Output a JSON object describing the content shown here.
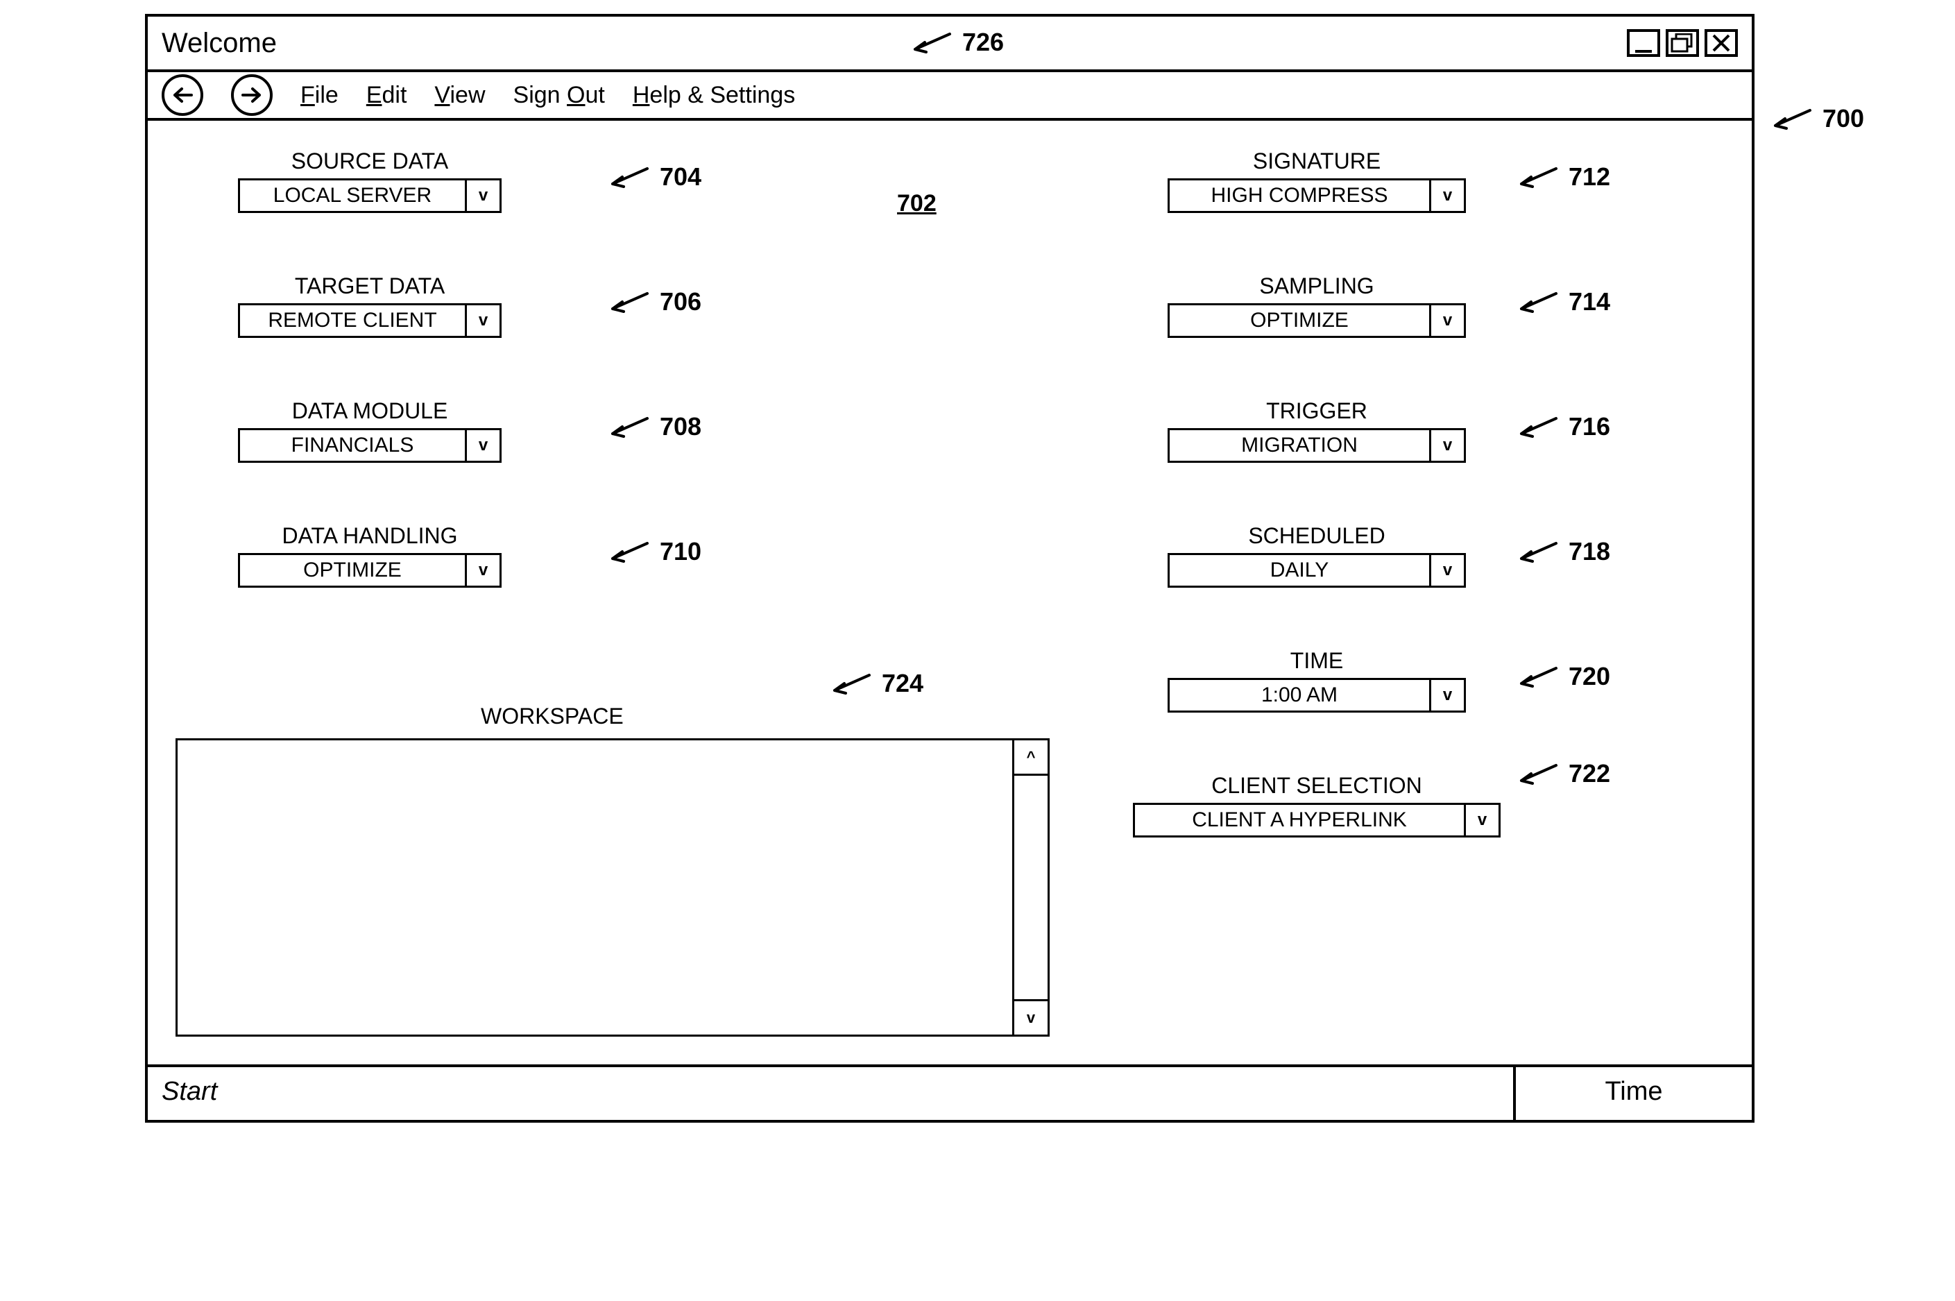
{
  "titlebar": {
    "title": "Welcome"
  },
  "menubar": {
    "file": "File",
    "edit": "Edit",
    "view": "View",
    "sign_out": "Sign Out",
    "help": "Help & Settings"
  },
  "central_ref": "702",
  "left": {
    "source_data": {
      "label": "SOURCE DATA",
      "value": "LOCAL SERVER"
    },
    "target_data": {
      "label": "TARGET DATA",
      "value": "REMOTE CLIENT"
    },
    "data_module": {
      "label": "DATA MODULE",
      "value": "FINANCIALS"
    },
    "data_handling": {
      "label": "DATA HANDLING",
      "value": "OPTIMIZE"
    }
  },
  "right": {
    "signature": {
      "label": "SIGNATURE",
      "value": "HIGH COMPRESS"
    },
    "sampling": {
      "label": "SAMPLING",
      "value": "OPTIMIZE"
    },
    "trigger": {
      "label": "TRIGGER",
      "value": "MIGRATION"
    },
    "scheduled": {
      "label": "SCHEDULED",
      "value": "DAILY"
    },
    "time": {
      "label": "TIME",
      "value": "1:00 AM"
    },
    "client_selection": {
      "label": "CLIENT SELECTION",
      "value": "CLIENT A HYPERLINK"
    }
  },
  "workspace": {
    "label": "WORKSPACE"
  },
  "statusbar": {
    "start": "Start",
    "time": "Time"
  },
  "callouts": {
    "c700": "700",
    "c704": "704",
    "c706": "706",
    "c708": "708",
    "c710": "710",
    "c712": "712",
    "c714": "714",
    "c716": "716",
    "c718": "718",
    "c720": "720",
    "c722": "722",
    "c724": "724",
    "c726": "726"
  }
}
